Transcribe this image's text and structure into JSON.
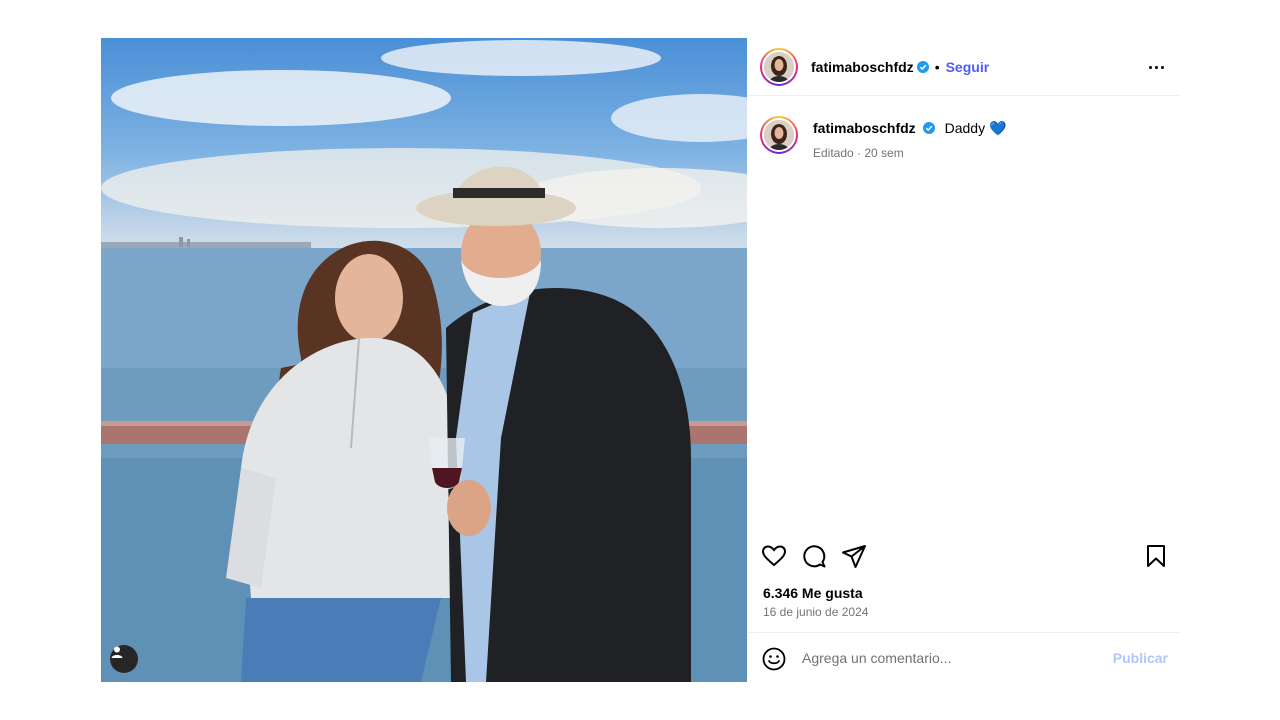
{
  "post": {
    "username": "fatimaboschfdz",
    "follow_label": "Seguir",
    "separator": "•",
    "caption_text": "Daddy 💙",
    "edited_meta": "Editado · 20 sem",
    "likes": "6.346 Me gusta",
    "date": "16 de junio de 2024"
  },
  "comment": {
    "placeholder": "Agrega un comentario...",
    "publish_label": "Publicar"
  },
  "icons": {
    "verified": "verified-badge-icon",
    "more": "more-options-icon",
    "like": "heart-icon",
    "comment": "comment-icon",
    "share": "share-icon",
    "save": "bookmark-icon",
    "emoji": "emoji-icon",
    "tagged_user": "user-tag-icon"
  },
  "colors": {
    "follow": "#4a5df9",
    "verified": "#1d9bf0",
    "publish_disabled": "#b3c5fb",
    "meta_text": "#737373"
  }
}
